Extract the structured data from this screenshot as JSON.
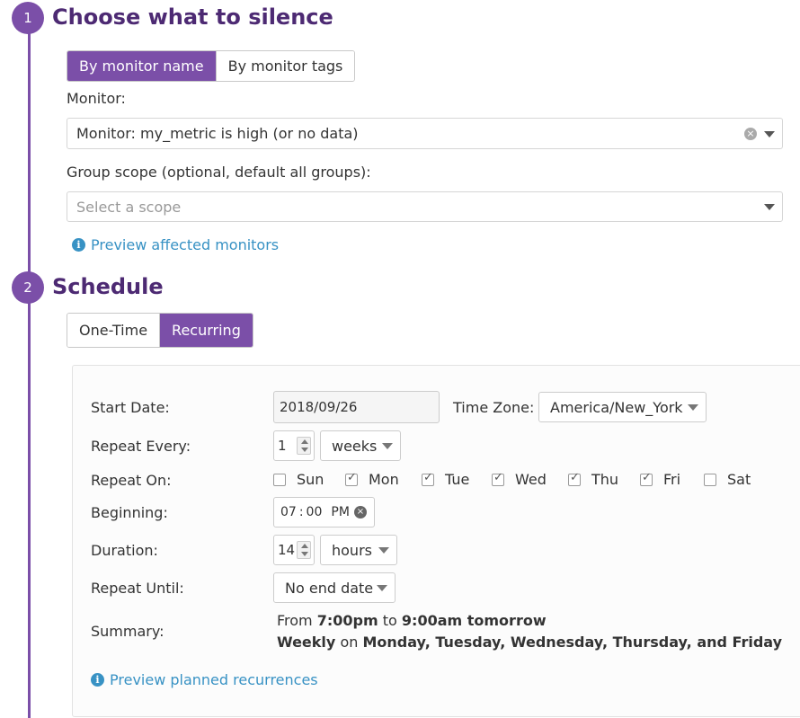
{
  "steps": {
    "one": {
      "number": "1",
      "title": "Choose what to silence",
      "mode_buttons": [
        "By monitor name",
        "By monitor tags"
      ],
      "monitor_label": "Monitor:",
      "monitor_value": "Monitor: my_metric is high (or no data)",
      "scope_label": "Group scope (optional, default all groups):",
      "scope_placeholder": "Select a scope",
      "preview_link": "Preview affected monitors"
    },
    "two": {
      "number": "2",
      "title": "Schedule",
      "mode_buttons": [
        "One-Time",
        "Recurring"
      ]
    }
  },
  "schedule": {
    "start_date_label": "Start Date:",
    "start_date_value": "2018/09/26",
    "time_zone_label": "Time Zone:",
    "time_zone_value": "America/New_York",
    "repeat_every_label": "Repeat Every:",
    "repeat_every_value": "1",
    "repeat_every_unit": "weeks",
    "repeat_on_label": "Repeat On:",
    "days": [
      {
        "label": "Sun",
        "checked": false
      },
      {
        "label": "Mon",
        "checked": true
      },
      {
        "label": "Tue",
        "checked": true
      },
      {
        "label": "Wed",
        "checked": true
      },
      {
        "label": "Thu",
        "checked": true
      },
      {
        "label": "Fri",
        "checked": true
      },
      {
        "label": "Sat",
        "checked": false
      }
    ],
    "beginning_label": "Beginning:",
    "beginning_hours": "07",
    "beginning_sep": ":",
    "beginning_minutes": "00",
    "beginning_ampm": "PM",
    "duration_label": "Duration:",
    "duration_value": "14",
    "duration_unit": "hours",
    "repeat_until_label": "Repeat Until:",
    "repeat_until_value": "No end date",
    "summary_label": "Summary:",
    "summary_line1": {
      "from": "From",
      "start": "7:00pm",
      "to": "to",
      "end": "9:00am tomorrow"
    },
    "summary_line2": {
      "freq": "Weekly",
      "on": "on",
      "days": "Monday, Tuesday, Wednesday, Thursday, and Friday"
    },
    "preview_link": "Preview planned recurrences"
  },
  "colors": {
    "accent": "#7b4fa8",
    "title": "#4d2a73",
    "link": "#3892c4"
  }
}
